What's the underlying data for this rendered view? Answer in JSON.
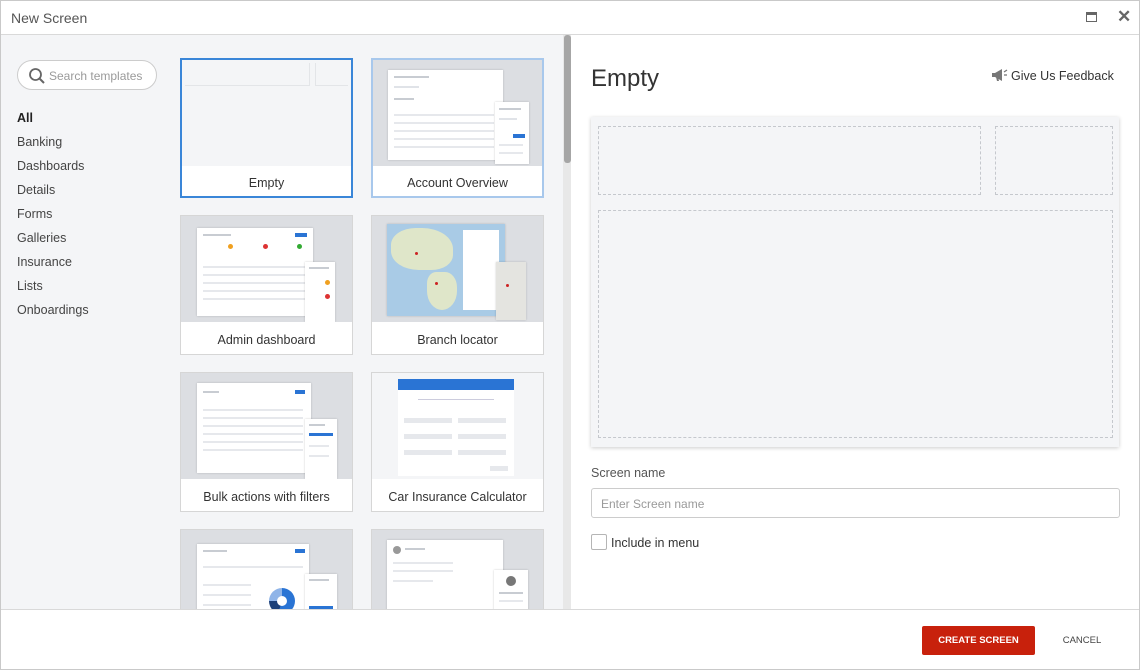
{
  "window": {
    "title": "New Screen",
    "maximize_icon": "maximize-icon",
    "close_icon": "close-icon",
    "close_glyph": "✕"
  },
  "search": {
    "placeholder": "Search templates",
    "icon": "search-icon"
  },
  "categories": [
    {
      "label": "All",
      "active": true
    },
    {
      "label": "Banking"
    },
    {
      "label": "Dashboards"
    },
    {
      "label": "Details"
    },
    {
      "label": "Forms"
    },
    {
      "label": "Galleries"
    },
    {
      "label": "Insurance"
    },
    {
      "label": "Lists"
    },
    {
      "label": "Onboardings"
    }
  ],
  "templates": [
    {
      "label": "Empty",
      "selected": true
    },
    {
      "label": "Account Overview",
      "hovered": true
    },
    {
      "label": "Admin dashboard"
    },
    {
      "label": "Branch locator"
    },
    {
      "label": "Bulk actions with filters"
    },
    {
      "label": "Car Insurance Calculator"
    },
    {
      "label": ""
    },
    {
      "label": ""
    }
  ],
  "preview": {
    "title": "Empty",
    "feedback_label": "Give Us Feedback",
    "feedback_icon": "megaphone-icon",
    "screen_name_label": "Screen name",
    "screen_name_placeholder": "Enter Screen name",
    "screen_name_value": "",
    "include_menu_label": "Include in menu",
    "include_menu_checked": false
  },
  "footer": {
    "create_label": "CREATE SCREEN",
    "cancel_label": "CANCEL"
  },
  "colors": {
    "accent": "#3a86d8",
    "primary_button": "#c8210c",
    "panel_bg": "#f4f5f7",
    "template_blue": "#2a74d4"
  }
}
